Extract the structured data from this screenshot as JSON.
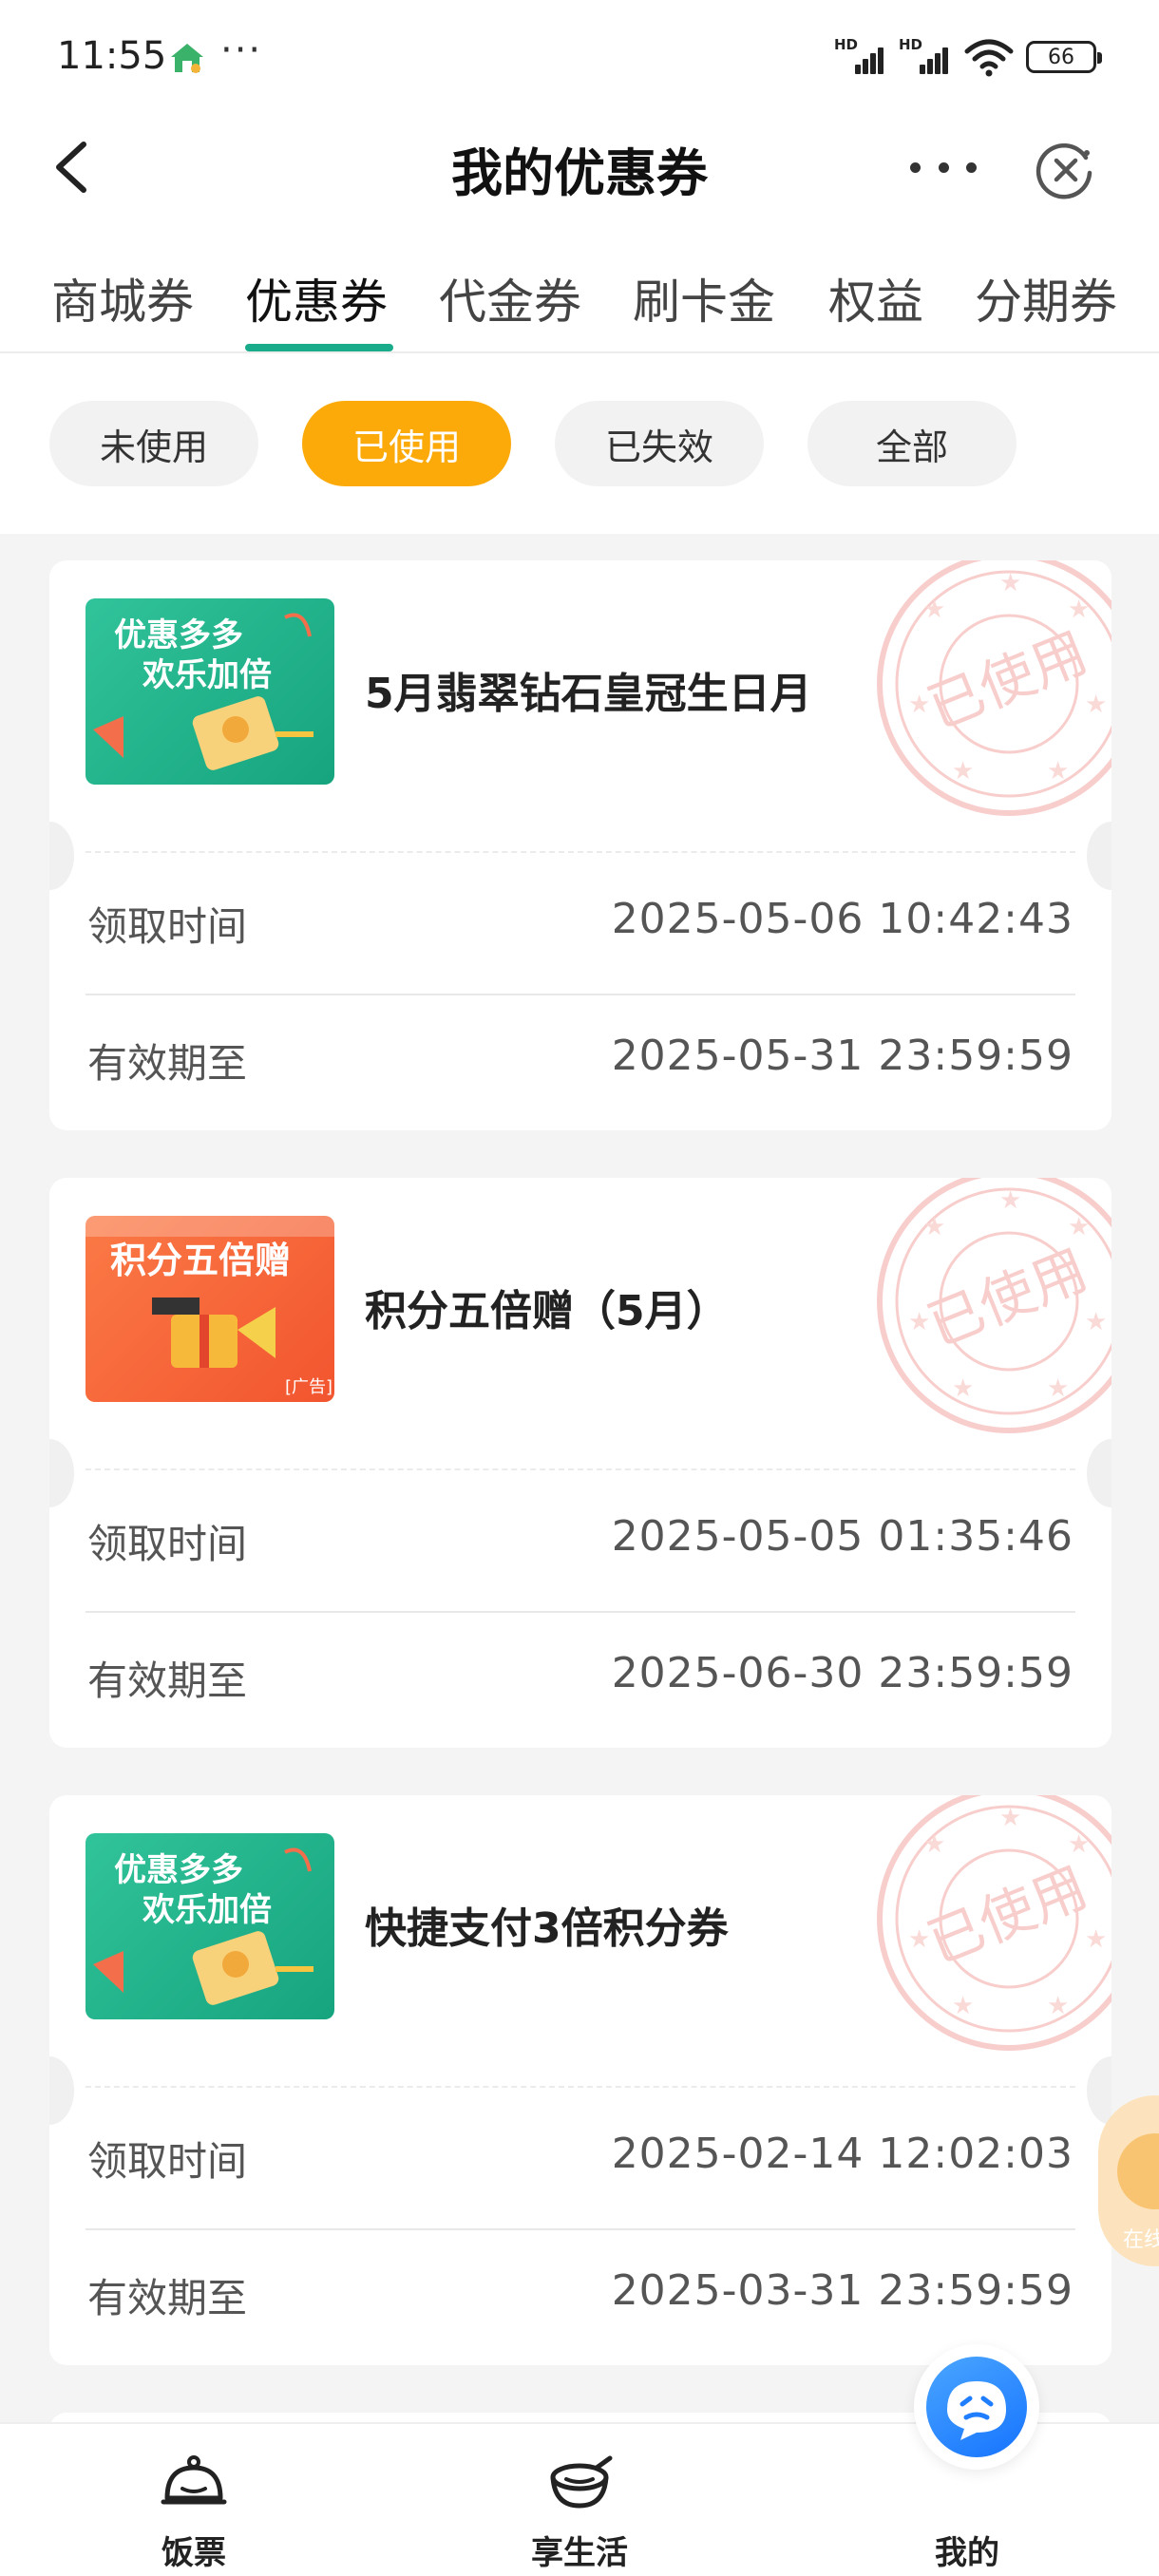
{
  "status_bar": {
    "time": "11:55",
    "dots": "···",
    "signal_1": "HD",
    "signal_2": "HD",
    "battery": "66",
    "icons": [
      "home-app-icon",
      "signal-icon",
      "signal-icon",
      "wifi-icon",
      "battery-icon"
    ]
  },
  "nav": {
    "title": "我的优惠券",
    "icons": [
      "back-icon",
      "more-icon",
      "close-icon"
    ]
  },
  "tabs": [
    {
      "label": "商城券",
      "active": false
    },
    {
      "label": "优惠券",
      "active": true
    },
    {
      "label": "代金券",
      "active": false
    },
    {
      "label": "刷卡金",
      "active": false
    },
    {
      "label": "权益",
      "active": false
    },
    {
      "label": "分期券",
      "active": false
    }
  ],
  "filters": [
    {
      "label": "未使用",
      "active": false
    },
    {
      "label": "已使用",
      "active": true
    },
    {
      "label": "已失效",
      "active": false
    },
    {
      "label": "全部",
      "active": false
    }
  ],
  "coupons": [
    {
      "title": "5月翡翠钻石皇冠生日月",
      "thumb_text_1": "优惠多多",
      "thumb_text_2": "欢乐加倍",
      "stamp_text": "已使用",
      "receive_label": "领取时间",
      "receive_time": "2025-05-06 10:42:43",
      "expire_label": "有效期至",
      "expire_time": "2025-05-31 23:59:59"
    },
    {
      "title": "积分五倍赠（5月）",
      "thumb_text_1": "积分五倍赠",
      "thumb_text_2": "[广告]",
      "stamp_text": "已使用",
      "receive_label": "领取时间",
      "receive_time": "2025-05-05 01:35:46",
      "expire_label": "有效期至",
      "expire_time": "2025-06-30 23:59:59"
    },
    {
      "title": "快捷支付3倍积分券",
      "thumb_text_1": "优惠多多",
      "thumb_text_2": "欢乐加倍",
      "stamp_text": "已使用",
      "receive_label": "领取时间",
      "receive_time": "2025-02-14 12:02:03",
      "expire_label": "有效期至",
      "expire_time": "2025-03-31 23:59:59"
    }
  ],
  "float_bubble": {
    "text": "在线"
  },
  "bottom_nav": [
    {
      "label": "饭票",
      "icon": "rice-bowl-icon"
    },
    {
      "label": "享生活",
      "icon": "bowl-icon"
    },
    {
      "label": "我的",
      "icon": "assistant-face-icon"
    }
  ],
  "colors": {
    "accent_green": "#1aab8a",
    "chip_active": "#fbaa0a",
    "stamp_red": "#f3a7a3",
    "thumb_green": "#24b48d",
    "thumb_orange": "#fa6a3c",
    "assistant_blue": "#1f7dff"
  }
}
